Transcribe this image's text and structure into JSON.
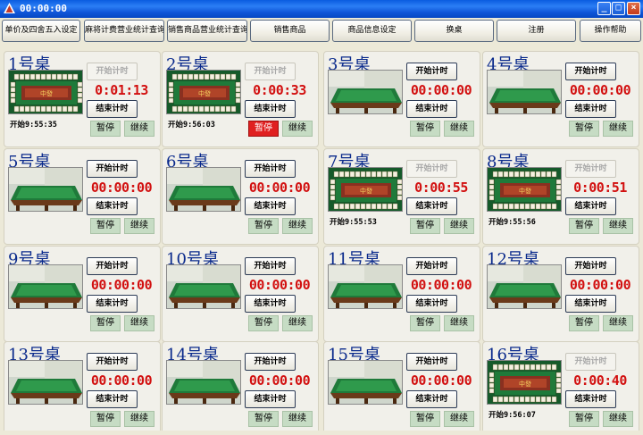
{
  "window": {
    "title": "00:00:00",
    "min_label": "_",
    "max_label": "□",
    "close_label": "×"
  },
  "toolbar": [
    {
      "label": "单价及四舍五入设定"
    },
    {
      "label": "麻将计费营业统计查询"
    },
    {
      "label": "销售商品营业统计查询"
    },
    {
      "label": "销售商品"
    },
    {
      "label": "商品信息设定"
    },
    {
      "label": "换桌"
    },
    {
      "label": "注册"
    },
    {
      "label": "操作帮助"
    }
  ],
  "labels": {
    "start": "开始计时",
    "end": "结束计时",
    "pause": "暂停",
    "resume": "继续"
  },
  "tables": [
    {
      "name": "1号桌",
      "timer": "0:01:13",
      "start_time": "开始9:55:35",
      "running": true,
      "paused": false
    },
    {
      "name": "2号桌",
      "timer": "0:00:33",
      "start_time": "开始9:56:03",
      "running": true,
      "paused": true
    },
    {
      "name": "3号桌",
      "timer": "00:00:00",
      "start_time": "",
      "running": false,
      "paused": false
    },
    {
      "name": "4号桌",
      "timer": "00:00:00",
      "start_time": "",
      "running": false,
      "paused": false
    },
    {
      "name": "5号桌",
      "timer": "00:00:00",
      "start_time": "",
      "running": false,
      "paused": false
    },
    {
      "name": "6号桌",
      "timer": "00:00:00",
      "start_time": "",
      "running": false,
      "paused": false
    },
    {
      "name": "7号桌",
      "timer": "0:00:55",
      "start_time": "开始9:55:53",
      "running": true,
      "paused": false
    },
    {
      "name": "8号桌",
      "timer": "0:00:51",
      "start_time": "开始9:55:56",
      "running": true,
      "paused": false
    },
    {
      "name": "9号桌",
      "timer": "00:00:00",
      "start_time": "",
      "running": false,
      "paused": false
    },
    {
      "name": "10号桌",
      "timer": "00:00:00",
      "start_time": "",
      "running": false,
      "paused": false
    },
    {
      "name": "11号桌",
      "timer": "00:00:00",
      "start_time": "",
      "running": false,
      "paused": false
    },
    {
      "name": "12号桌",
      "timer": "00:00:00",
      "start_time": "",
      "running": false,
      "paused": false
    },
    {
      "name": "13号桌",
      "timer": "00:00:00",
      "start_time": "",
      "running": false,
      "paused": false
    },
    {
      "name": "14号桌",
      "timer": "00:00:00",
      "start_time": "",
      "running": false,
      "paused": false
    },
    {
      "name": "15号桌",
      "timer": "00:00:00",
      "start_time": "",
      "running": false,
      "paused": false
    },
    {
      "name": "16号桌",
      "timer": "0:00:40",
      "start_time": "开始9:56:07",
      "running": true,
      "paused": false
    }
  ],
  "colors": {
    "titlebar": "#0a5ce0",
    "timer": "#d21010",
    "table_name": "#0a2a8c",
    "felt_green": "#1f7a3a",
    "pause_active": "#e02020",
    "action_bg": "#c6dcc4"
  }
}
